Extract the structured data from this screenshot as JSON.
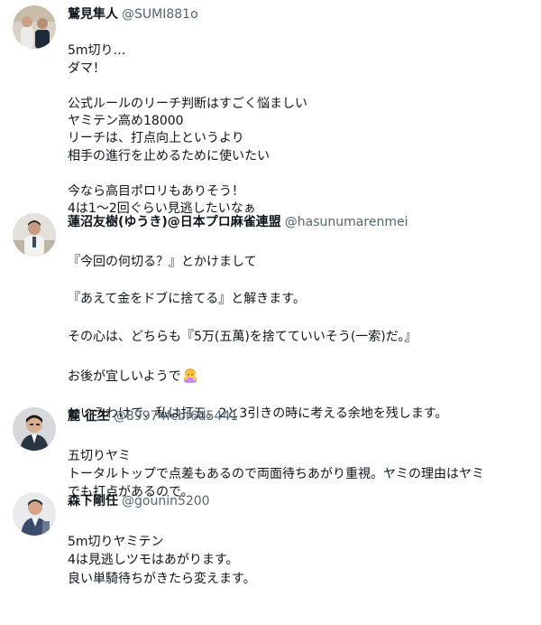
{
  "tweets": [
    {
      "display_name": "鷲見隼人",
      "handle": "@SUMI881o",
      "avatar_icon": "user-avatar-icon",
      "lines": [
        "5m切り…",
        "ダマ！",
        "",
        "公式ルールのリーチ判断はすごく悩ましい",
        "ヤミテン高め18000",
        "リーチは、打点向上というより",
        "相手の進行を止めるために使いたい",
        "",
        "今なら高目ポロリもありそう！",
        "4は1～2回ぐらい見逃したいなぁ"
      ]
    },
    {
      "display_name": "蓮沼友樹(ゆうき)@日本プロ麻雀連盟",
      "handle": "@hasunumarenmei",
      "avatar_icon": "user-avatar-icon",
      "lines": [
        "『今回の何切る？』とかけまして",
        "",
        "『あえて金をドブに捨てる』と解きます。",
        "",
        "その心は、どちらも『5万(五萬)を捨てていいそう(一索)だ。』",
        "",
        "お後が宜しいようで",
        "",
        "というわけで、私は打五。2と3引きの時に考える余地を残します。"
      ],
      "emoji_icon": "bowing-person-emoji-icon"
    },
    {
      "display_name": "麓 征生",
      "handle": "@89974fcbf6d5441",
      "avatar_icon": "user-avatar-icon",
      "lines": [
        "五切りヤミ",
        "トータルトップで点差もあるので両面待ちあがり重視。ヤミの理由はヤミ",
        "でも打点があるので。"
      ]
    },
    {
      "display_name": "森下剛任",
      "handle": "@gounin5200",
      "avatar_icon": "user-avatar-icon",
      "lines": [
        "5m切りヤミテン",
        "4は見逃しツモはあがります。",
        "良い単騎待ちがきたら変えます。"
      ]
    }
  ]
}
